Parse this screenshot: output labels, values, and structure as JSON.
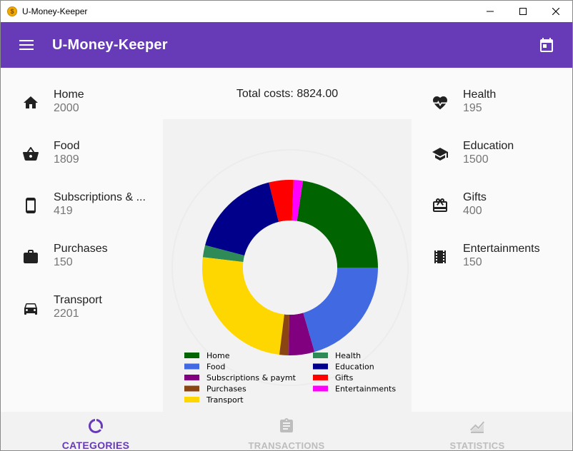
{
  "window": {
    "title": "U-Money-Keeper",
    "icon_letter": "$"
  },
  "appbar": {
    "title": "U-Money-Keeper",
    "accent": "#673ab7"
  },
  "total": {
    "text": "Total costs: 8824.00"
  },
  "left_categories": [
    {
      "name": "Home",
      "amount": "2000",
      "icon": "home-icon"
    },
    {
      "name": "Food",
      "amount": "1809",
      "icon": "basket-icon"
    },
    {
      "name": "Subscriptions & ...",
      "amount": "419",
      "icon": "phone-icon"
    },
    {
      "name": "Purchases",
      "amount": "150",
      "icon": "briefcase-icon"
    },
    {
      "name": "Transport",
      "amount": "2201",
      "icon": "car-icon"
    }
  ],
  "right_categories": [
    {
      "name": "Health",
      "amount": "195",
      "icon": "heart-pulse-icon"
    },
    {
      "name": "Education",
      "amount": "1500",
      "icon": "graduation-cap-icon"
    },
    {
      "name": "Gifts",
      "amount": "400",
      "icon": "gift-icon"
    },
    {
      "name": "Entertainments",
      "amount": "150",
      "icon": "film-icon"
    }
  ],
  "chart_data": {
    "type": "pie",
    "donut": true,
    "slices": [
      {
        "label": "Home",
        "value": 2000,
        "color": "#006400"
      },
      {
        "label": "Entertainments",
        "value": 150,
        "color": "#ff00ff"
      },
      {
        "label": "Gifts",
        "value": 400,
        "color": "#ff0000"
      },
      {
        "label": "Education",
        "value": 1500,
        "color": "#00008b"
      },
      {
        "label": "Health",
        "value": 195,
        "color": "#2e8b57"
      },
      {
        "label": "Transport",
        "value": 2201,
        "color": "#ffd700"
      },
      {
        "label": "Purchases",
        "value": 150,
        "color": "#8b4513"
      },
      {
        "label": "Subscriptions & paymt",
        "value": 419,
        "color": "#800080"
      },
      {
        "label": "Food",
        "value": 1809,
        "color": "#4169e1"
      }
    ],
    "legend": [
      {
        "label": "Home",
        "color": "#006400"
      },
      {
        "label": "Food",
        "color": "#4169e1"
      },
      {
        "label": "Subscriptions & paymt",
        "color": "#800080"
      },
      {
        "label": "Purchases",
        "color": "#8b4513"
      },
      {
        "label": "Transport",
        "color": "#ffd700"
      },
      {
        "label": "Health",
        "color": "#2e8b57"
      },
      {
        "label": "Education",
        "color": "#00008b"
      },
      {
        "label": "Gifts",
        "color": "#ff0000"
      },
      {
        "label": "Entertainments",
        "color": "#ff00ff"
      }
    ],
    "legend_placement": "bottom"
  },
  "bottom_nav": [
    {
      "label": "CATEGORIES",
      "icon": "donut-chart-icon",
      "active": true
    },
    {
      "label": "TRANSACTIONS",
      "icon": "clipboard-icon",
      "active": false
    },
    {
      "label": "STATISTICS",
      "icon": "area-chart-icon",
      "active": false
    }
  ]
}
